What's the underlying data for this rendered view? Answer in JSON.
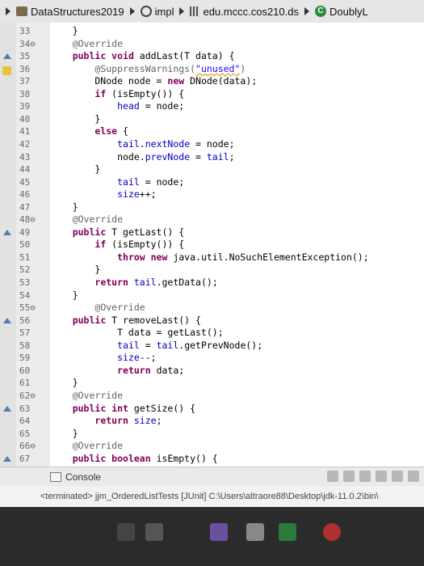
{
  "breadcrumb": [
    "DataStructures2019",
    "impl",
    "edu.mccc.cos210.ds",
    "DoublyL"
  ],
  "code_lines": [
    {
      "n": "33",
      "html": "    }"
    },
    {
      "n": "34",
      "fold": true,
      "html": "    <span class='ann'>@Override</span>"
    },
    {
      "n": "35",
      "marker": "tri",
      "html": "    <span class='kw'>public void</span> addLast(T data) {"
    },
    {
      "n": "36",
      "marker": "warn",
      "html": "        <span class='ann'>@SuppressWarnings(</span><span class='str'>\"unused\"</span><span class='ann'>)</span>"
    },
    {
      "n": "37",
      "html": "        DNode node = <span class='kw'>new</span> DNode(data);"
    },
    {
      "n": "38",
      "html": "        <span class='kw'>if</span> (isEmpty()) {"
    },
    {
      "n": "39",
      "html": "            <span class='fld'>head</span> = node;"
    },
    {
      "n": "40",
      "html": "        }"
    },
    {
      "n": "41",
      "html": "        <span class='kw'>else</span> {"
    },
    {
      "n": "42",
      "html": "            <span class='fld'>tail</span>.<span class='fld'>nextNode</span> = node;"
    },
    {
      "n": "43",
      "html": "            node.<span class='fld'>prevNode</span> = <span class='fld'>tail</span>;"
    },
    {
      "n": "44",
      "html": "        }"
    },
    {
      "n": "45",
      "html": "            <span class='fld'>tail</span> = node;"
    },
    {
      "n": "46",
      "html": "            <span class='fld'>size</span>++;"
    },
    {
      "n": "47",
      "html": "    }"
    },
    {
      "n": "48",
      "fold": true,
      "html": "    <span class='ann'>@Override</span>"
    },
    {
      "n": "49",
      "marker": "tri",
      "html": "    <span class='kw'>public</span> T getLast() {"
    },
    {
      "n": "50",
      "html": "        <span class='kw'>if</span> (isEmpty()) {"
    },
    {
      "n": "51",
      "html": "            <span class='kw'>throw new</span> java.util.NoSuchElementException();"
    },
    {
      "n": "52",
      "html": "        }"
    },
    {
      "n": "53",
      "html": "        <span class='kw'>return</span> <span class='fld'>tail</span>.getData();"
    },
    {
      "n": "54",
      "html": "    }"
    },
    {
      "n": "55",
      "fold": true,
      "html": "        <span class='ann'>@Override</span>"
    },
    {
      "n": "56",
      "marker": "tri",
      "html": "    <span class='kw'>public</span> T removeLast() {"
    },
    {
      "n": "57",
      "html": "            T data = getLast();"
    },
    {
      "n": "58",
      "html": "            <span class='fld'>tail</span> = <span class='fld'>tail</span>.getPrevNode();"
    },
    {
      "n": "59",
      "html": "            <span class='fld'>size</span>--;"
    },
    {
      "n": "60",
      "html": "            <span class='kw'>return</span> data;"
    },
    {
      "n": "61",
      "html": "    }"
    },
    {
      "n": "62",
      "fold": true,
      "html": "    <span class='ann'>@Override</span>"
    },
    {
      "n": "63",
      "marker": "tri",
      "html": "    <span class='kw'>public int</span> getSize() {"
    },
    {
      "n": "64",
      "html": "        <span class='kw'>return</span> <span class='fld'>size</span>;"
    },
    {
      "n": "65",
      "html": "    }"
    },
    {
      "n": "66",
      "fold": true,
      "html": "    <span class='ann'>@Override</span>"
    },
    {
      "n": "67",
      "marker": "tri",
      "html": "    <span class='kw'>public boolean</span> isEmpty() {"
    }
  ],
  "console": {
    "tab_label": "Console",
    "status": "<terminated> jjm_OrderedListTests [JUnit] C:\\Users\\altraore88\\Desktop\\jdk-11.0.2\\bin\\"
  },
  "colors": {
    "keyword": "#7f0055",
    "field": "#0000c0",
    "annotation": "#646464",
    "string": "#2a00ff"
  }
}
